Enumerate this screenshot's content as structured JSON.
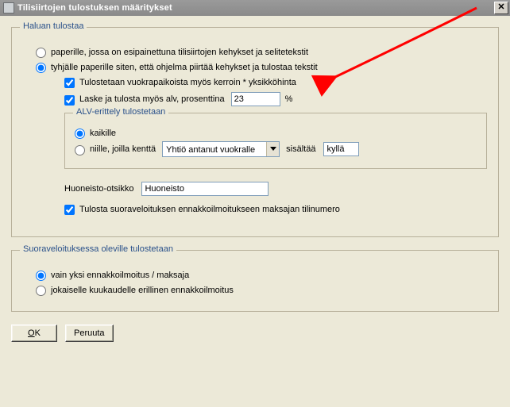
{
  "window": {
    "title": "Tilisiirtojen tulostuksen määritykset",
    "close_glyph": "✕"
  },
  "group_print": {
    "legend": "Haluan tulostaa",
    "radio_preprinted": "paperille, jossa on esipainettuna tilisiirtojen kehykset ja selitetekstit",
    "radio_blank": "tyhjälle paperille siten, että ohjelma piirtää kehykset ja tulostaa tekstit",
    "chk_kerroin": "Tulostetaan vuokrapaikoista myös kerroin * yksikköhinta",
    "chk_alv_label": "Laske ja tulosta myös alv, prosenttina",
    "alv_value": "23",
    "alv_pct": "%",
    "alv_group": {
      "legend": "ALV-erittely tulostetaan",
      "radio_all": "kaikille",
      "radio_filtered": "niille, joilla kenttä",
      "combo_selected": "Yhtiö antanut vuokralle",
      "contains_label": "sisältää",
      "contains_value": "kyllä"
    },
    "huone_label": "Huoneisto-otsikko",
    "huone_value": "Huoneisto",
    "chk_tilinumero": "Tulosta suoraveloituksen ennakkoilmoitukseen maksajan tilinumero"
  },
  "group_suora": {
    "legend": "Suoraveloituksessa oleville tulostetaan",
    "radio_one": "vain yksi ennakkoilmoitus / maksaja",
    "radio_each": "jokaiselle kuukaudelle erillinen ennakkoilmoitus"
  },
  "buttons": {
    "ok_prefix": "O",
    "ok_rest": "K",
    "cancel": "Peruuta"
  }
}
